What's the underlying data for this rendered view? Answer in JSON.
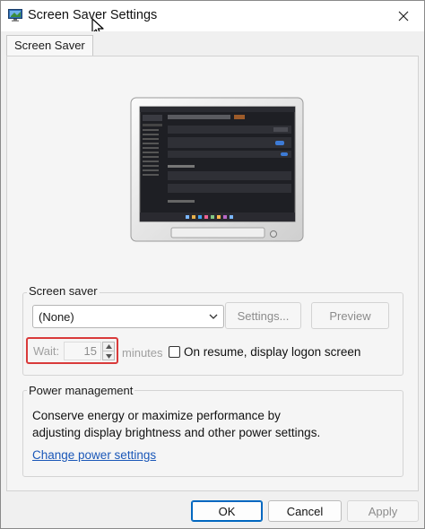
{
  "window": {
    "title": "Screen Saver Settings",
    "close_glyph": "✕"
  },
  "tabs": [
    {
      "label": "Screen Saver"
    }
  ],
  "screen_saver": {
    "group_label": "Screen saver",
    "selected": "(None)",
    "settings_label": "Settings...",
    "preview_label": "Preview",
    "wait_label": "Wait:",
    "wait_value": "15",
    "minutes_label": "minutes",
    "resume_checked": false,
    "resume_label": "On resume, display logon screen"
  },
  "power": {
    "group_label": "Power management",
    "description": "Conserve energy or maximize performance by adjusting display brightness and other power settings.",
    "link_label": "Change power settings"
  },
  "footer": {
    "ok_label": "OK",
    "cancel_label": "Cancel",
    "apply_label": "Apply"
  },
  "colors": {
    "accent": "#0067c0",
    "highlight_border": "#d93a3a",
    "link": "#1a57b8"
  },
  "icons": {
    "app": "screen-saver-app-icon",
    "cursor": "mouse-cursor-icon",
    "close": "close-icon",
    "dropdown": "chevron-down-icon",
    "spin_up": "spin-up-icon",
    "spin_down": "spin-down-icon"
  }
}
